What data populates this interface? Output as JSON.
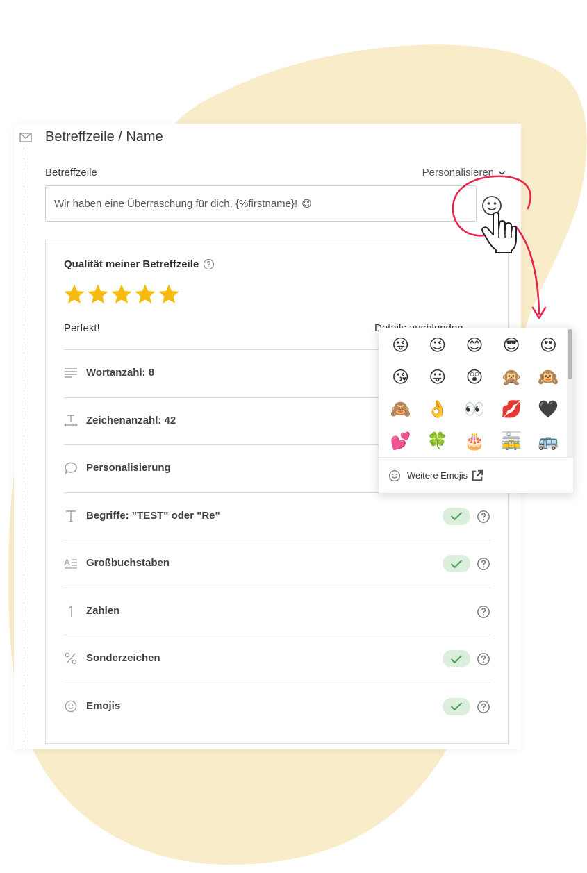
{
  "section": {
    "title": "Betreffzeile / Name"
  },
  "subject": {
    "label": "Betreffzeile",
    "personalize_label": "Personalisieren",
    "value": "Wir haben eine Überraschung für dich, {%firstname}!",
    "value_emoji": "😊"
  },
  "quality": {
    "title": "Qualität meiner Betreffzeile",
    "rating_stars": 5,
    "rating_max": 5,
    "rating_text": "Perfekt!",
    "details_toggle": "Details ausblenden",
    "criteria": [
      {
        "label": "Wortanzahl: 8",
        "icon": "text-lines-icon",
        "passed": null
      },
      {
        "label": "Zeichenanzahl: 42",
        "icon": "text-length-icon",
        "passed": null
      },
      {
        "label": "Personalisierung",
        "icon": "speech-bubble-icon",
        "passed": null
      },
      {
        "label": "Begriffe: \"TEST\" oder \"Re\"",
        "icon": "text-t-icon",
        "passed": true
      },
      {
        "label": "Großbuchstaben",
        "icon": "uppercase-icon",
        "passed": true
      },
      {
        "label": "Zahlen",
        "icon": "number-one-icon",
        "passed": false
      },
      {
        "label": "Sonderzeichen",
        "icon": "percent-icon",
        "passed": true
      },
      {
        "label": "Emojis",
        "icon": "smiley-icon",
        "passed": true
      }
    ]
  },
  "emoji_picker": {
    "emojis": [
      "😜",
      "😉",
      "😊",
      "😎",
      "😍",
      "😘",
      "😛",
      "😲",
      "🙊",
      "🙉",
      "🙈",
      "👌",
      "👀",
      "💋",
      "🖤",
      "💕",
      "🍀",
      "🎂",
      "🚋",
      "🚌"
    ],
    "more_label": "Weitere Emojis"
  },
  "colors": {
    "blob": "#f9ecc8",
    "star": "#f6bb0f",
    "check_bg": "#dcefdc",
    "check": "#4a9c55",
    "annotation": "#e8234f"
  }
}
